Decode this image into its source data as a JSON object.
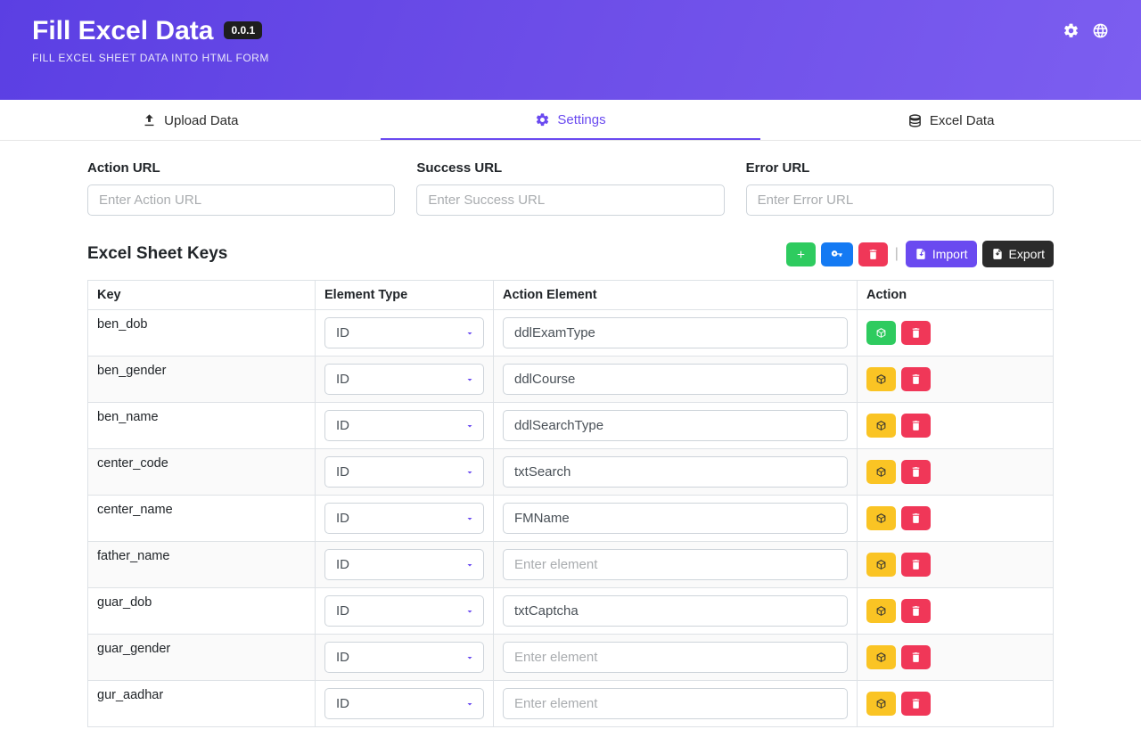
{
  "header": {
    "title": "Fill Excel Data",
    "version": "0.0.1",
    "subtitle": "FILL EXCEL SHEET DATA INTO HTML FORM"
  },
  "tabs": {
    "upload": "Upload Data",
    "settings": "Settings",
    "excel": "Excel Data"
  },
  "urls": {
    "action": {
      "label": "Action URL",
      "placeholder": "Enter Action URL",
      "value": ""
    },
    "success": {
      "label": "Success URL",
      "placeholder": "Enter Success URL",
      "value": ""
    },
    "error": {
      "label": "Error URL",
      "placeholder": "Enter Error URL",
      "value": ""
    }
  },
  "section": {
    "title": "Excel Sheet Keys"
  },
  "toolbar": {
    "import": "Import",
    "export": "Export"
  },
  "table": {
    "headers": {
      "key": "Key",
      "type": "Element Type",
      "element": "Action Element",
      "action": "Action"
    },
    "element_placeholder": "Enter element",
    "rows": [
      {
        "key": "ben_dob",
        "type": "ID",
        "element": "ddlExamType",
        "row_variant": "green"
      },
      {
        "key": "ben_gender",
        "type": "ID",
        "element": "ddlCourse",
        "row_variant": "yellow"
      },
      {
        "key": "ben_name",
        "type": "ID",
        "element": "ddlSearchType",
        "row_variant": "yellow"
      },
      {
        "key": "center_code",
        "type": "ID",
        "element": "txtSearch",
        "row_variant": "yellow"
      },
      {
        "key": "center_name",
        "type": "ID",
        "element": "FMName",
        "row_variant": "yellow"
      },
      {
        "key": "father_name",
        "type": "ID",
        "element": "",
        "row_variant": "yellow"
      },
      {
        "key": "guar_dob",
        "type": "ID",
        "element": "txtCaptcha",
        "row_variant": "yellow"
      },
      {
        "key": "guar_gender",
        "type": "ID",
        "element": "",
        "row_variant": "yellow"
      },
      {
        "key": "gur_aadhar",
        "type": "ID",
        "element": "",
        "row_variant": "yellow"
      }
    ]
  }
}
